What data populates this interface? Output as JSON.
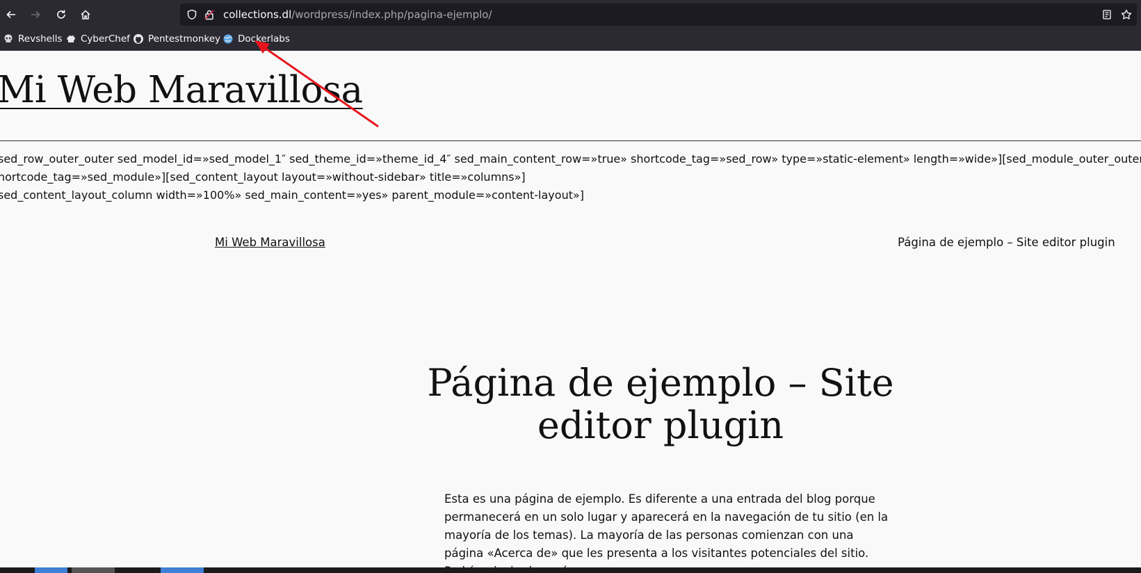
{
  "browser": {
    "url_host": "collections.dl",
    "url_path": "/wordpress/index.php/pagina-ejemplo/"
  },
  "bookmarks": [
    {
      "label": "Revshells",
      "icon": "skull-icon"
    },
    {
      "label": "CyberChef",
      "icon": "chef-hat-icon"
    },
    {
      "label": "Pentestmonkey",
      "icon": "github-icon"
    },
    {
      "label": "Dockerlabs",
      "icon": "globe-icon"
    }
  ],
  "page": {
    "site_title": "Mi Web Maravillosa",
    "shortcode_lines": [
      "sed_row_outer_outer sed_model_id=»sed_model_1″ sed_theme_id=»theme_id_4″ sed_main_content_row=»true» shortcode_tag=»sed_row» type=»static-element» length=»wide»][sed_module_outer_outer sed_",
      "hortcode_tag=»sed_module»][sed_content_layout layout=»without-sidebar» title=»columns»]",
      "sed_content_layout_column width=»100%» sed_main_content=»yes» parent_module=»content-layout»]"
    ],
    "nav_home": "Mi Web Maravillosa",
    "nav_current": "Página de ejemplo – Site editor plugin",
    "page_title": "Página de ejemplo – Site editor plugin",
    "body_text": "Esta es una página de ejemplo. Es diferente a una entrada del blog porque permanecerá en un solo lugar y aparecerá en la navegación de tu sitio (en la mayoría de los temas). La mayoría de las personas comienzan con una página «Acerca de» que les presenta a los visitantes potenciales del sitio. Podrías decir algo así:"
  },
  "annotation": {
    "color": "#e8141b"
  }
}
